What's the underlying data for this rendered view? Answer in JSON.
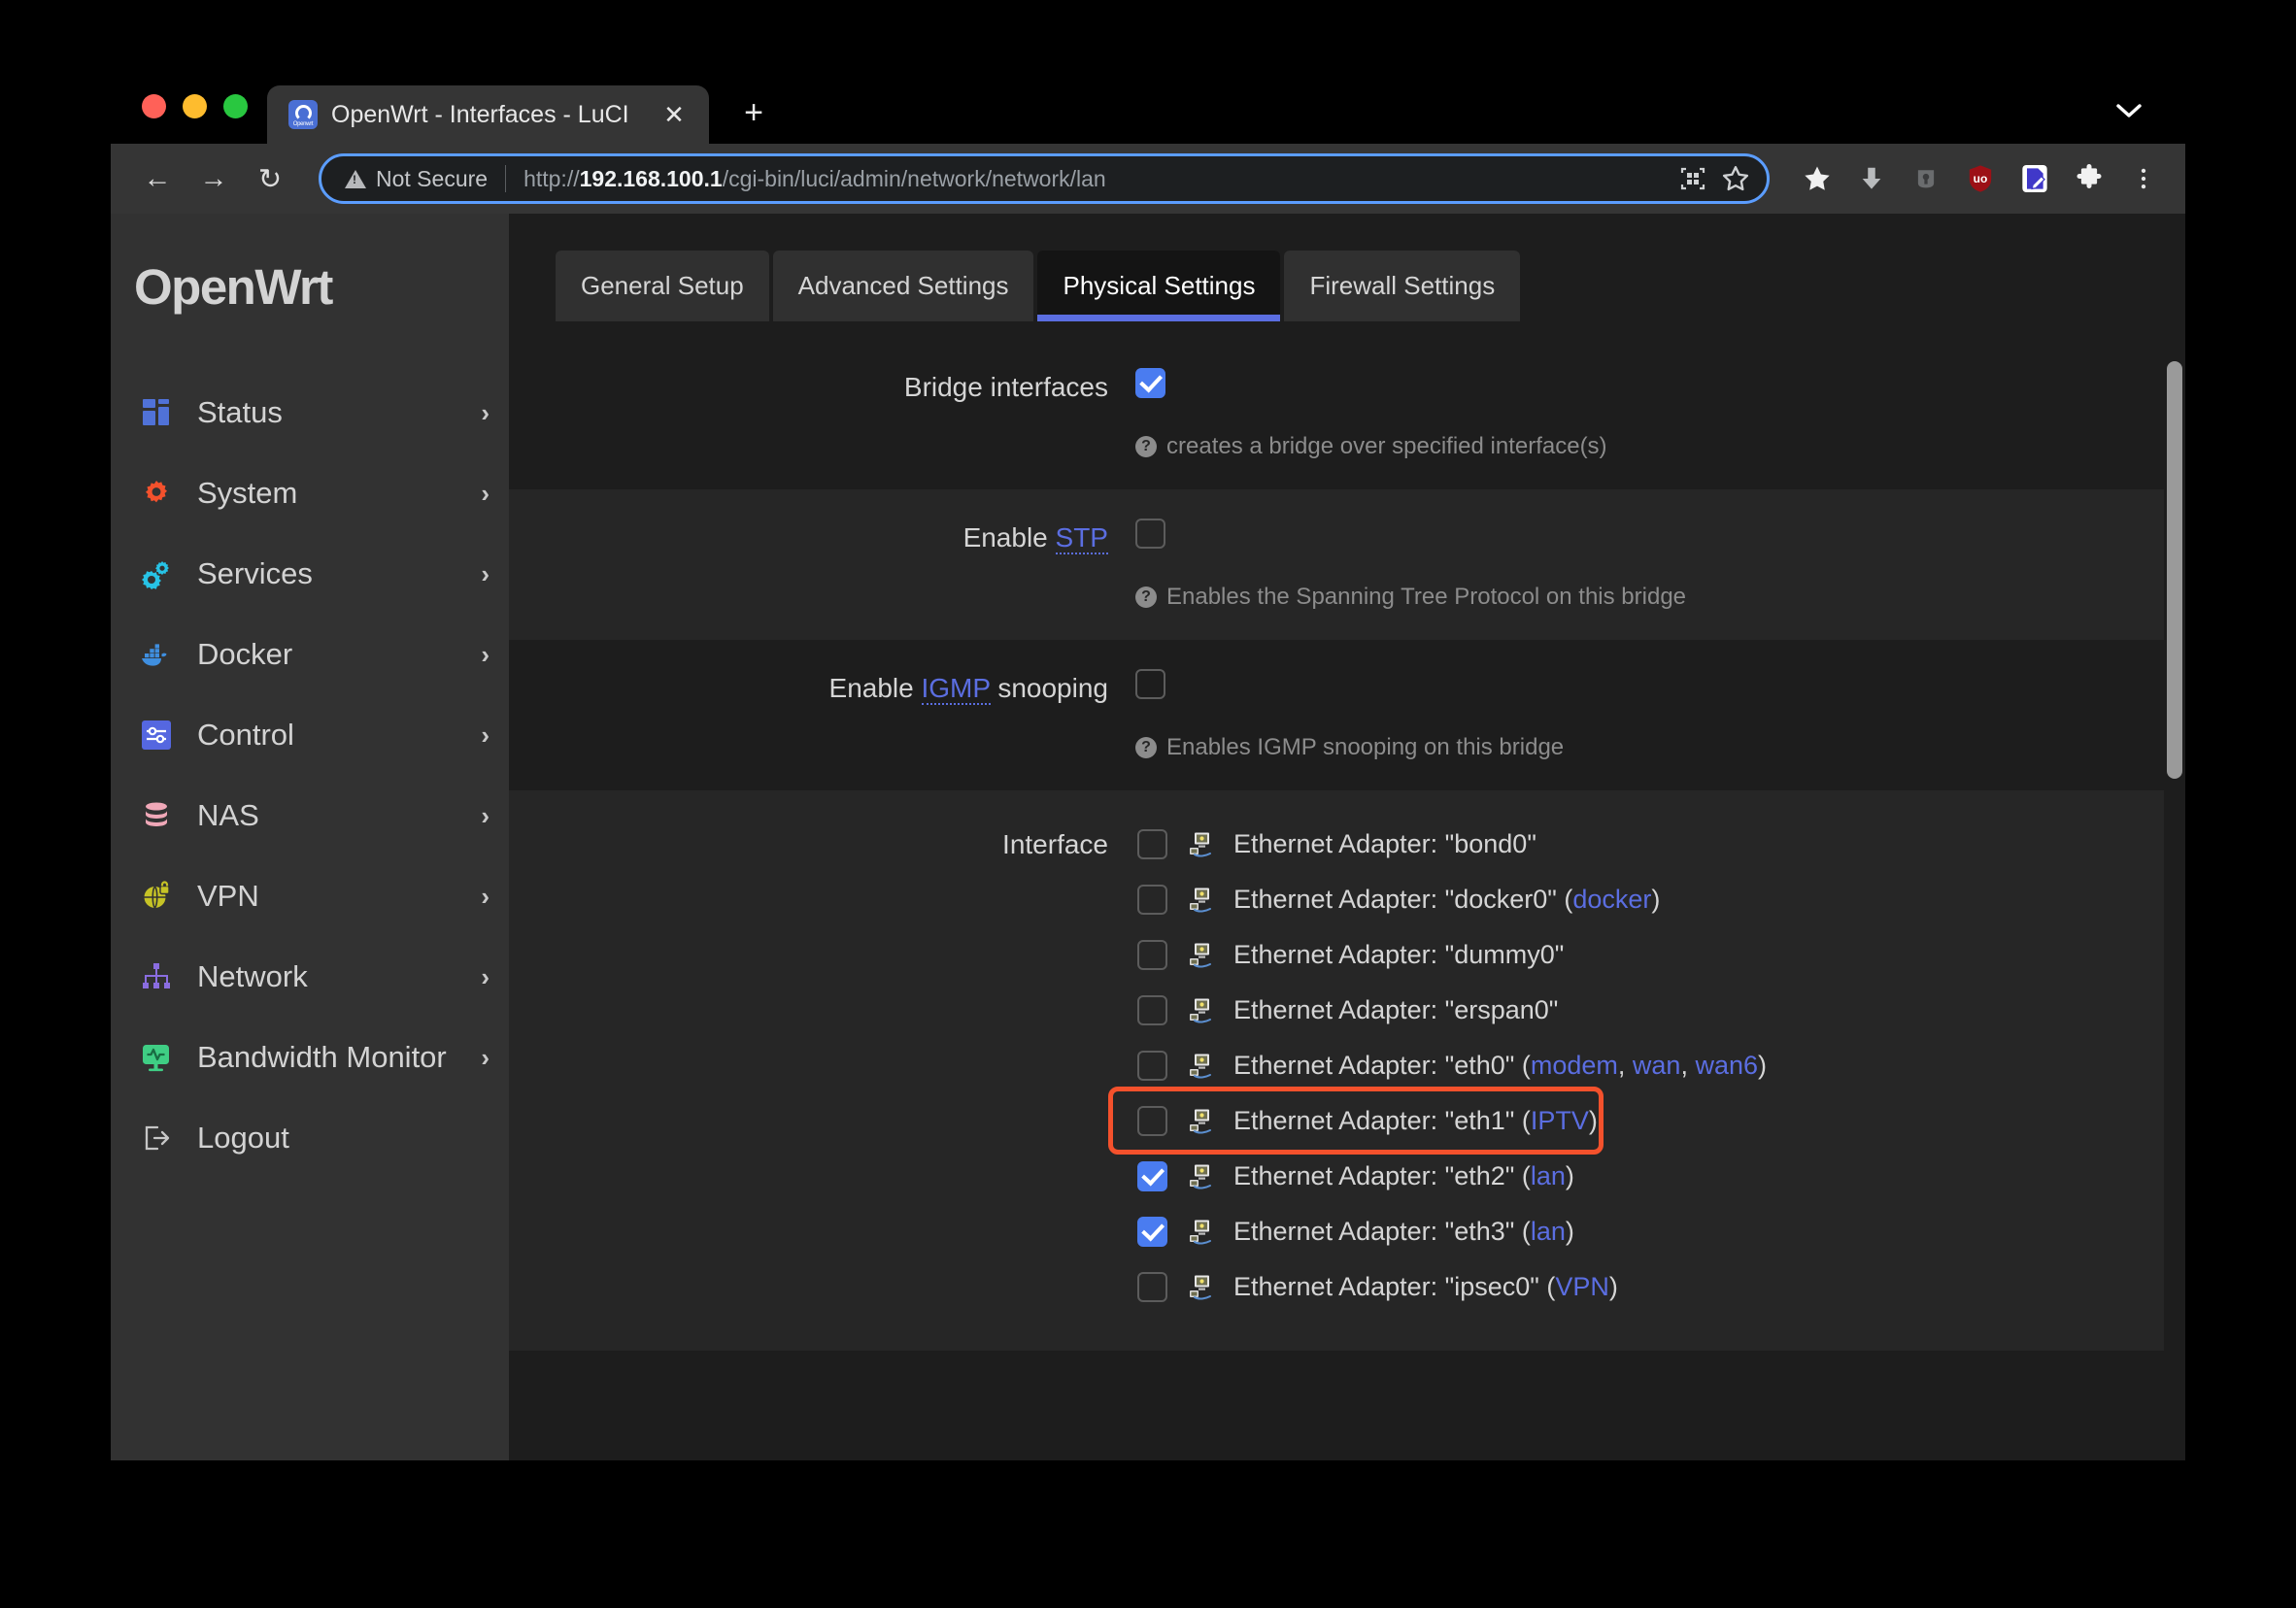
{
  "browser": {
    "tab": {
      "title": "OpenWrt - Interfaces - LuCI",
      "favicon_word": "Openwrt",
      "close_label": "✕"
    },
    "new_tab_label": "+",
    "tabstrip_chevron": "⌄",
    "nav": {
      "back": "←",
      "forward": "→",
      "reload": "↻"
    },
    "omnibox": {
      "security_label": "Not Secure",
      "url_scheme": "http://",
      "url_host": "192.168.100.1",
      "url_path": "/cgi-bin/luci/admin/network/network/lan"
    },
    "toolbar_icons": [
      "qr-code-icon",
      "bookmark-star-icon",
      "bookmarks-star-icon",
      "downloads-icon",
      "password-key-icon",
      "ublock-origin-icon",
      "markdown-editor-extension-icon",
      "extensions-puzzle-icon",
      "chrome-menu-icon"
    ],
    "ublock_label": "uo"
  },
  "sidebar": {
    "brand": "OpenWrt",
    "items": [
      {
        "label": "Status",
        "icon": "grid-icon",
        "chevron": "›"
      },
      {
        "label": "System",
        "icon": "gear-icon",
        "chevron": "›"
      },
      {
        "label": "Services",
        "icon": "gears-icon",
        "chevron": "›"
      },
      {
        "label": "Docker",
        "icon": "docker-icon",
        "chevron": "›"
      },
      {
        "label": "Control",
        "icon": "sliders-icon",
        "chevron": "›"
      },
      {
        "label": "NAS",
        "icon": "database-icon",
        "chevron": "›"
      },
      {
        "label": "VPN",
        "icon": "globe-lock-icon",
        "chevron": "›"
      },
      {
        "label": "Network",
        "icon": "sitemap-icon",
        "chevron": "›"
      },
      {
        "label": "Bandwidth Monitor",
        "icon": "monitor-pulse-icon",
        "chevron": "›"
      },
      {
        "label": "Logout",
        "icon": "logout-icon",
        "chevron": ""
      }
    ]
  },
  "content": {
    "tabs": [
      {
        "label": "General Setup",
        "active": false
      },
      {
        "label": "Advanced Settings",
        "active": false
      },
      {
        "label": "Physical Settings",
        "active": true
      },
      {
        "label": "Firewall Settings",
        "active": false
      }
    ],
    "fields": {
      "bridge": {
        "label": "Bridge interfaces",
        "checked": true,
        "help": "creates a bridge over specified interface(s)"
      },
      "stp": {
        "label_before": "Enable ",
        "label_abbr": "STP",
        "label_after": "",
        "checked": false,
        "help": "Enables the Spanning Tree Protocol on this bridge"
      },
      "igmp": {
        "label_before": "Enable ",
        "label_abbr": "IGMP",
        "label_after": " snooping",
        "checked": false,
        "help": "Enables IGMP snooping on this bridge"
      },
      "interface": {
        "label": "Interface",
        "items": [
          {
            "name": "Ethernet Adapter: \"bond0\"",
            "networks": [],
            "checked": false,
            "highlighted": false
          },
          {
            "name": "Ethernet Adapter: \"docker0\"",
            "networks": [
              "docker"
            ],
            "checked": false,
            "highlighted": false
          },
          {
            "name": "Ethernet Adapter: \"dummy0\"",
            "networks": [],
            "checked": false,
            "highlighted": false
          },
          {
            "name": "Ethernet Adapter: \"erspan0\"",
            "networks": [],
            "checked": false,
            "highlighted": false
          },
          {
            "name": "Ethernet Adapter: \"eth0\"",
            "networks": [
              "modem",
              "wan",
              "wan6"
            ],
            "checked": false,
            "highlighted": false
          },
          {
            "name": "Ethernet Adapter: \"eth1\"",
            "networks": [
              "IPTV"
            ],
            "checked": false,
            "highlighted": true
          },
          {
            "name": "Ethernet Adapter: \"eth2\"",
            "networks": [
              "lan"
            ],
            "checked": true,
            "highlighted": false
          },
          {
            "name": "Ethernet Adapter: \"eth3\"",
            "networks": [
              "lan"
            ],
            "checked": true,
            "highlighted": false
          },
          {
            "name": "Ethernet Adapter: \"ipsec0\"",
            "networks": [
              "VPN"
            ],
            "checked": false,
            "highlighted": false
          }
        ]
      }
    }
  },
  "colors": {
    "accent_blue": "#5b6ee1",
    "checkbox_blue": "#4a7cf0",
    "highlight_orange": "#f4512c",
    "sidebar_bg": "#323232",
    "content_bg": "#1d1d1d"
  }
}
